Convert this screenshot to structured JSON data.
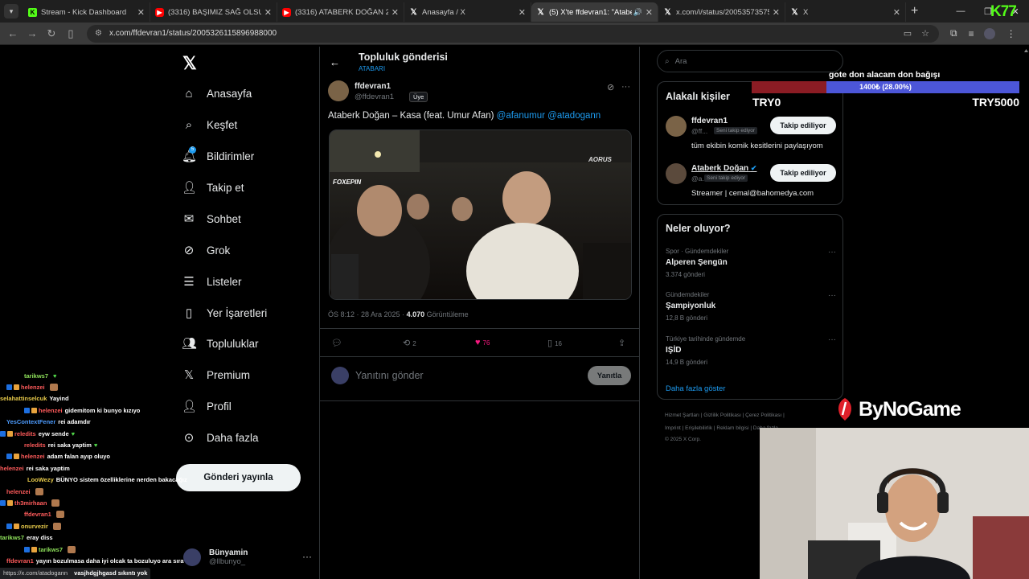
{
  "browser": {
    "tabs": [
      {
        "label": "Stream - Kick Dashboard",
        "favicon": "kick-icon",
        "active": false
      },
      {
        "label": "(3316) BAŞIMIZ SAĞ OLSUN | M",
        "favicon": "youtube-icon",
        "active": false
      },
      {
        "label": "(3316) ATABERK DOĞAN 2025",
        "favicon": "youtube-icon",
        "active": false
      },
      {
        "label": "Anasayfa / X",
        "favicon": "x-icon",
        "active": false
      },
      {
        "label": "(5) X'te ffdevran1: \"Ataberk",
        "favicon": "x-icon",
        "active": true
      },
      {
        "label": "x.com/i/status/20053573575",
        "favicon": "x-icon",
        "active": false
      },
      {
        "label": "X",
        "favicon": "x-icon",
        "active": false
      }
    ],
    "url": "x.com/ffdevran1/status/2005326115896988000"
  },
  "nav": {
    "items": [
      {
        "label": "Anasayfa",
        "icon": "home-icon"
      },
      {
        "label": "Keşfet",
        "icon": "search-icon"
      },
      {
        "label": "Bildirimler",
        "icon": "bell-icon",
        "badge": "5"
      },
      {
        "label": "Takip et",
        "icon": "add-user-icon"
      },
      {
        "label": "Sohbet",
        "icon": "mail-icon"
      },
      {
        "label": "Grok",
        "icon": "grok-icon"
      },
      {
        "label": "Listeler",
        "icon": "list-icon"
      },
      {
        "label": "Yer İşaretleri",
        "icon": "bookmark-icon"
      },
      {
        "label": "Topluluklar",
        "icon": "communities-icon"
      },
      {
        "label": "Premium",
        "icon": "x-premium-icon"
      },
      {
        "label": "Profil",
        "icon": "profile-icon"
      },
      {
        "label": "Daha fazla",
        "icon": "more-circle-icon"
      }
    ],
    "post_button": "Gönderi yayınla",
    "user": {
      "name": "Bünyamin",
      "handle": "@llbunyo_"
    }
  },
  "main": {
    "title": "Topluluk gönderisi",
    "subtitle": "ATABARI",
    "author": {
      "name": "ffdevran1",
      "handle": "@ffdevran1",
      "badge": "Üye"
    },
    "text_prefix": "Ataberk Doğan – Kasa (feat. Umur Afan)",
    "mention1": "@afanumur",
    "mention2": "@atadogann",
    "video_overlay_left": "FOXEPIN",
    "video_overlay_right": "AORUS",
    "meta": {
      "time": "ÖS 8:12 · 28 Ara 2025 · ",
      "views": "4.070",
      "views_label": " Görüntüleme"
    },
    "actions": {
      "retweets": "2",
      "likes": "76",
      "bookmarks": "16"
    },
    "reply_placeholder": "Yanıtını gönder",
    "reply_button": "Yanıtla"
  },
  "sidebar": {
    "search_placeholder": "Ara",
    "relevant_title": "Alakalı kişiler",
    "people": [
      {
        "name": "ffdevran1",
        "handle": "@ff...",
        "follows_you": "Seni takip ediyor",
        "button": "Takip ediliyor",
        "bio": "tüm ekibin komik kesitlerini paylaşıyom",
        "verified": false
      },
      {
        "name": "Ataberk Doğan",
        "handle": "@a...",
        "follows_you": "Seni takip ediyor",
        "button": "Takip ediliyor",
        "bio": "Streamer | cemal@bahomedya.com",
        "verified": true
      }
    ],
    "trends_title": "Neler oluyor?",
    "trends": [
      {
        "category": "Spor · Gündemdekiler",
        "name": "Alperen Şengün",
        "count": "3.374 gönderi"
      },
      {
        "category": "Gündemdekiler",
        "name": "Şampiyonluk",
        "count": "12,8 B gönderi"
      },
      {
        "category": "Türkiye tarihinde gündemde",
        "name": "IŞİD",
        "count": "14,9 B gönderi"
      }
    ],
    "show_more": "Daha fazla göster",
    "footer_line1": "Hizmet Şartları  |  Gizlilik Politikası  |  Çerez Politikası  |",
    "footer_line2": "Imprint  |  Erişilebilirlik  |  Reklam bilgisi  |  Daha fazla ···",
    "footer_line3": "© 2025 X Corp."
  },
  "chat": [
    {
      "user": "tarikws7",
      "color": "#8ee05a",
      "text": "",
      "emote": "heart"
    },
    {
      "user": "helenzei",
      "color": "#ff5b5b",
      "text": "",
      "emote": "img"
    },
    {
      "user": "selahattinselcuk",
      "color": "#e6c94a",
      "text": "Yayind",
      "emote": ""
    },
    {
      "user": "helenzei",
      "color": "#ff5b5b",
      "text": "gidemitom ki bunyo kızıyo",
      "emote": ""
    },
    {
      "user": "YesContextFener",
      "color": "#4d9cff",
      "text": "rei adamdır",
      "emote": ""
    },
    {
      "user": "reledits",
      "color": "#ff5b5b",
      "text": "eyw sende",
      "emote": "heart"
    },
    {
      "user": "reledits",
      "color": "#ff5b5b",
      "text": "rei saka yaptim",
      "emote": "heart"
    },
    {
      "user": "helenzei",
      "color": "#ff5b5b",
      "text": "adam falan ayıp oluyo",
      "emote": ""
    },
    {
      "user": "helenzei",
      "color": "#ff5b5b",
      "text": "rei saka yaptim",
      "emote": ""
    },
    {
      "user": "LooWezy",
      "color": "#e6c94a",
      "text": "BÜNYO sistem özelliklerine nerden bakacağız",
      "emote": ""
    },
    {
      "user": "helenzei",
      "color": "#ff5b5b",
      "text": "",
      "emote": "img"
    },
    {
      "user": "th3mirhaan",
      "color": "#ff5b5b",
      "text": "",
      "emote": "img"
    },
    {
      "user": "ffdevran1",
      "color": "#ff5b5b",
      "text": "",
      "emote": "img"
    },
    {
      "user": "onurvezir",
      "color": "#e6c94a",
      "text": "",
      "emote": "img"
    },
    {
      "user": "tarikws7",
      "color": "#8ee05a",
      "text": "eray diss",
      "emote": ""
    },
    {
      "user": "tarikws7",
      "color": "#8ee05a",
      "text": "",
      "emote": "img"
    },
    {
      "user": "ffdevran1",
      "color": "#ff5b5b",
      "text": "yayın bozulmasa daha iyi olcak ta bozuluyo ara sıra",
      "emote": ""
    }
  ],
  "status_bar": {
    "url": "https://x.com/atadogann",
    "chat_tail": "vasjhdgjhgasd sıkıntı yok"
  },
  "donation": {
    "goal_title": "gote don alacam don bağışı",
    "value_text": "1400₺ (28.00%)",
    "progress": 0.28,
    "min_label": "TRY0",
    "max_label": "TRY5000",
    "fill_color": "#8b1c24",
    "bar_color": "#4c56d8"
  },
  "sponsor": "ByNoGame",
  "kick_logo": "K77"
}
